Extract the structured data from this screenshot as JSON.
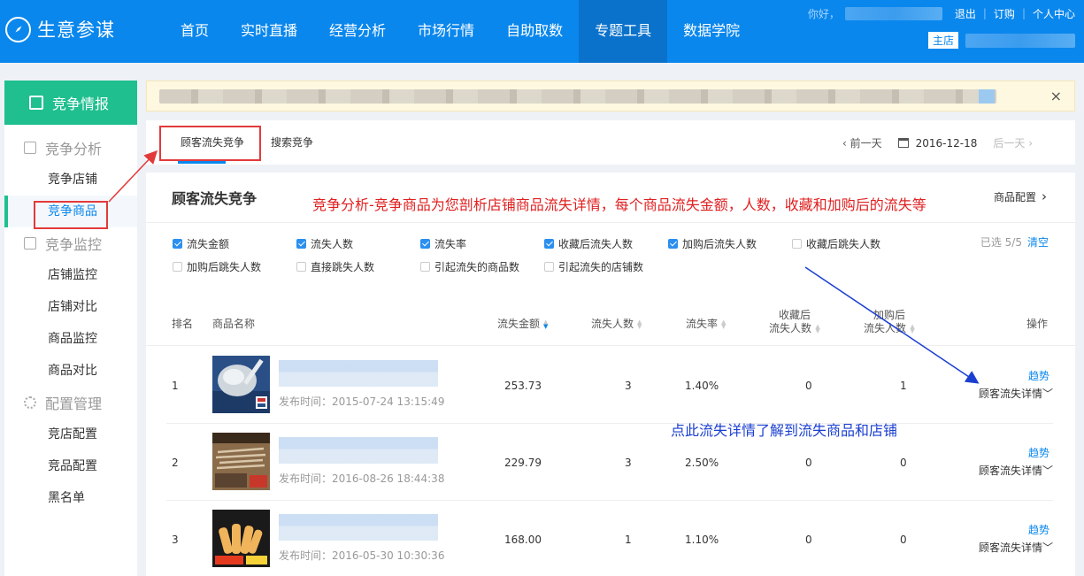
{
  "app": {
    "name": "生意参谋"
  },
  "nav": {
    "items": [
      "首页",
      "实时直播",
      "经营分析",
      "市场行情",
      "自助取数",
      "专题工具",
      "数据学院"
    ],
    "active": "专题工具"
  },
  "user": {
    "greeting": "你好，",
    "logout": "退出",
    "order": "订购",
    "profile": "个人中心",
    "shop_badge": "主店"
  },
  "sidebar": {
    "header": "竞争情报",
    "groups": [
      {
        "title": "竞争分析",
        "items": [
          "竞争店铺",
          "竞争商品"
        ]
      },
      {
        "title": "竞争监控",
        "items": [
          "店铺监控",
          "店铺对比",
          "商品监控",
          "商品对比"
        ]
      },
      {
        "title": "配置管理",
        "items": [
          "竞店配置",
          "竞品配置",
          "黑名单"
        ]
      }
    ],
    "active_item": "竞争商品"
  },
  "notice": {
    "close": "×"
  },
  "tabs": {
    "items": [
      "顾客流失竞争",
      "搜索竞争"
    ],
    "active": "顾客流失竞争"
  },
  "date_nav": {
    "prev": "前一天",
    "date": "2016-12-18",
    "next": "后一天"
  },
  "panel": {
    "title": "顾客流失竞争",
    "config": "商品配置"
  },
  "annotations": {
    "top": "竞争分析-竞争商品为您剖析店铺商品流失详情，每个商品流失金额，人数，收藏和加购后的流失等",
    "bottom": "点此流失详情了解到流失商品和店铺"
  },
  "metrics": [
    {
      "label": "流失金额",
      "checked": true
    },
    {
      "label": "流失人数",
      "checked": true
    },
    {
      "label": "流失率",
      "checked": true
    },
    {
      "label": "收藏后流失人数",
      "checked": true
    },
    {
      "label": "加购后流失人数",
      "checked": true
    },
    {
      "label": "收藏后跳失人数",
      "checked": false
    },
    {
      "label": "加购后跳失人数",
      "checked": false
    },
    {
      "label": "直接跳失人数",
      "checked": false
    },
    {
      "label": "引起流失的商品数",
      "checked": false
    },
    {
      "label": "引起流失的店铺数",
      "checked": false
    }
  ],
  "selected_info": {
    "text": "已选 5/5",
    "clear": "清空"
  },
  "table": {
    "headers": {
      "rank": "排名",
      "name": "商品名称",
      "amount": "流失金额",
      "people": "流失人数",
      "rate": "流失率",
      "fav_1": "收藏后",
      "fav_2": "流失人数",
      "cart_1": "加购后",
      "cart_2": "流失人数",
      "action": "操作"
    },
    "rows": [
      {
        "rank": "1",
        "published": "发布时间：2015-07-24 13:15:49",
        "amount": "253.73",
        "people": "3",
        "rate": "1.40%",
        "fav_loss": "0",
        "cart_loss": "1",
        "trend": "趋势",
        "detail": "顾客流失详情"
      },
      {
        "rank": "2",
        "published": "发布时间：2016-08-26 18:44:38",
        "amount": "229.79",
        "people": "3",
        "rate": "2.50%",
        "fav_loss": "0",
        "cart_loss": "0",
        "trend": "趋势",
        "detail": "顾客流失详情"
      },
      {
        "rank": "3",
        "published": "发布时间：2016-05-30 10:30:36",
        "amount": "168.00",
        "people": "1",
        "rate": "1.10%",
        "fav_loss": "0",
        "cart_loss": "0",
        "trend": "趋势",
        "detail": "顾客流失详情"
      }
    ]
  },
  "colors": {
    "primary": "#0a87ed",
    "accent_green": "#1fbf8f",
    "annotation_red": "#e02020",
    "annotation_blue": "#1a3fd0"
  }
}
